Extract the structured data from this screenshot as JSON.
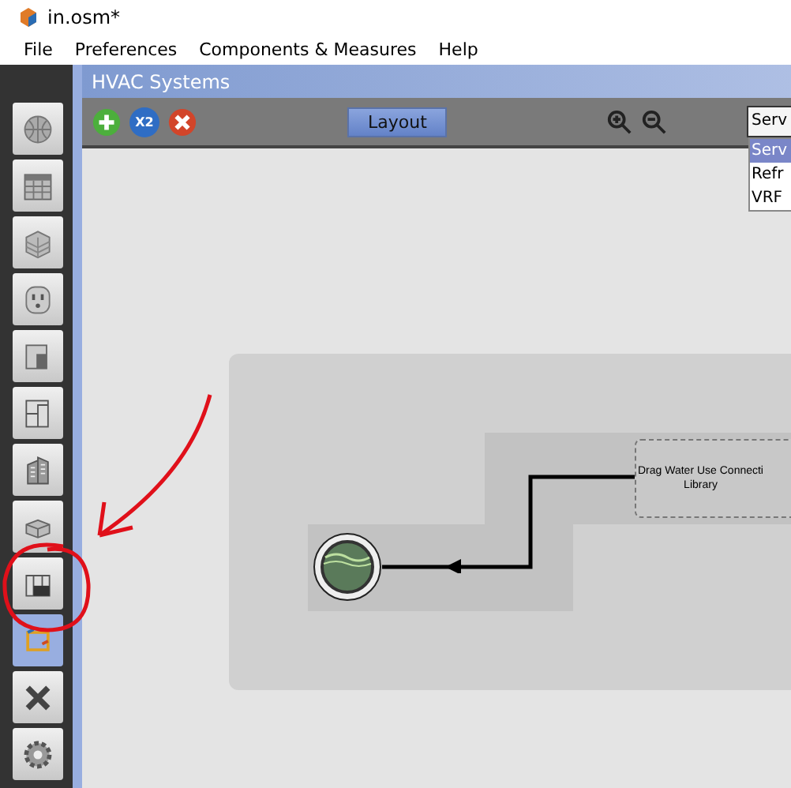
{
  "window": {
    "title": "in.osm*"
  },
  "menu": [
    "File",
    "Preferences",
    "Components & Measures",
    "Help"
  ],
  "sidebar": {
    "items": [
      {
        "selected": false
      },
      {
        "selected": false
      },
      {
        "selected": false
      },
      {
        "selected": false
      },
      {
        "selected": false
      },
      {
        "selected": false
      },
      {
        "selected": false
      },
      {
        "selected": false
      },
      {
        "selected": false
      },
      {
        "selected": true
      },
      {
        "selected": false
      },
      {
        "selected": false
      }
    ]
  },
  "panel": {
    "title": "HVAC Systems",
    "toolbar": {
      "duplicate_label": "X2",
      "layout_button": "Layout",
      "dropdown": {
        "value": "Serv",
        "expanded": true,
        "options": [
          {
            "label": "Serv",
            "selected": true
          },
          {
            "label": "Refr",
            "selected": false
          },
          {
            "label": "VRF",
            "selected": false
          }
        ]
      }
    },
    "canvas": {
      "drop_zone": {
        "lines": [
          "Drag Water Use Connecti",
          "Library"
        ]
      }
    }
  }
}
